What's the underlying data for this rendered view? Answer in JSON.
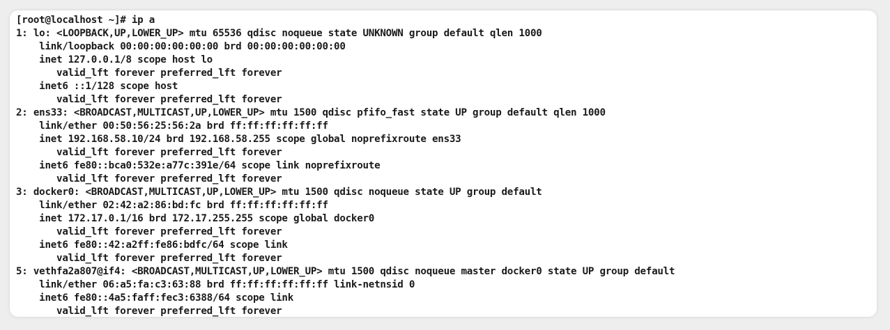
{
  "terminal": {
    "lines": [
      "[root@localhost ~]# ip a",
      "1: lo: <LOOPBACK,UP,LOWER_UP> mtu 65536 qdisc noqueue state UNKNOWN group default qlen 1000",
      "    link/loopback 00:00:00:00:00:00 brd 00:00:00:00:00:00",
      "    inet 127.0.0.1/8 scope host lo",
      "       valid_lft forever preferred_lft forever",
      "    inet6 ::1/128 scope host",
      "       valid_lft forever preferred_lft forever",
      "2: ens33: <BROADCAST,MULTICAST,UP,LOWER_UP> mtu 1500 qdisc pfifo_fast state UP group default qlen 1000",
      "    link/ether 00:50:56:25:56:2a brd ff:ff:ff:ff:ff:ff",
      "    inet 192.168.58.10/24 brd 192.168.58.255 scope global noprefixroute ens33",
      "       valid_lft forever preferred_lft forever",
      "    inet6 fe80::bca0:532e:a77c:391e/64 scope link noprefixroute",
      "       valid_lft forever preferred_lft forever",
      "3: docker0: <BROADCAST,MULTICAST,UP,LOWER_UP> mtu 1500 qdisc noqueue state UP group default",
      "    link/ether 02:42:a2:86:bd:fc brd ff:ff:ff:ff:ff:ff",
      "    inet 172.17.0.1/16 brd 172.17.255.255 scope global docker0",
      "       valid_lft forever preferred_lft forever",
      "    inet6 fe80::42:a2ff:fe86:bdfc/64 scope link",
      "       valid_lft forever preferred_lft forever",
      "5: vethfa2a807@if4: <BROADCAST,MULTICAST,UP,LOWER_UP> mtu 1500 qdisc noqueue master docker0 state UP group default",
      "    link/ether 06:a5:fa:c3:63:88 brd ff:ff:ff:ff:ff:ff link-netnsid 0",
      "    inet6 fe80::4a5:faff:fec3:6388/64 scope link",
      "       valid_lft forever preferred_lft forever"
    ]
  }
}
